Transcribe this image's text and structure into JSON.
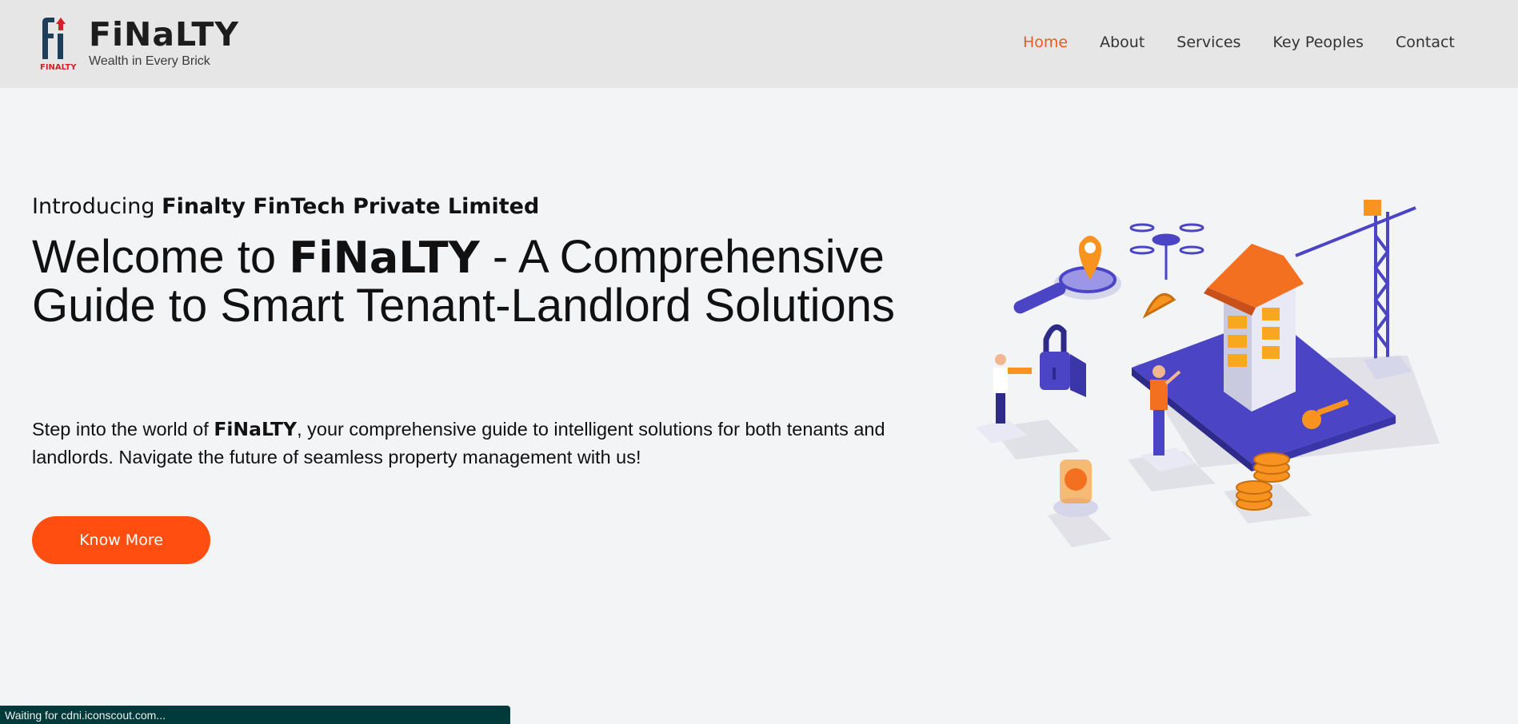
{
  "header": {
    "logo_small_text": "FINALTY",
    "brand_name": "FiNaLTY",
    "tagline": "Wealth in Every Brick",
    "nav": [
      {
        "label": "Home",
        "active": true
      },
      {
        "label": "About",
        "active": false
      },
      {
        "label": "Services",
        "active": false
      },
      {
        "label": "Key Peoples",
        "active": false
      },
      {
        "label": "Contact",
        "active": false
      }
    ]
  },
  "hero": {
    "intro_prefix": "Introducing ",
    "intro_company": "Finalty FinTech Private Limited",
    "headline_prefix": "Welcome to ",
    "headline_brand": "FiNaLTY",
    "headline_suffix": " - A Comprehensive Guide to Smart Tenant-Landlord Solutions",
    "desc_prefix": "Step into the world of ",
    "desc_brand": "FiNaLTY",
    "desc_suffix": ", your comprehensive guide to intelligent solutions for both tenants and landlords. Navigate the future of seamless property management with us!",
    "cta_label": "Know More"
  },
  "status": {
    "text": "Waiting for cdni.iconscout.com..."
  },
  "colors": {
    "accent": "#ff4e10",
    "nav_active": "#ea5b1d",
    "header_bg": "#e6e6e6",
    "page_bg": "#f3f4f6",
    "status_bg": "#003a3a",
    "illustration_purple": "#4b45c6",
    "illustration_orange": "#f7931e"
  }
}
